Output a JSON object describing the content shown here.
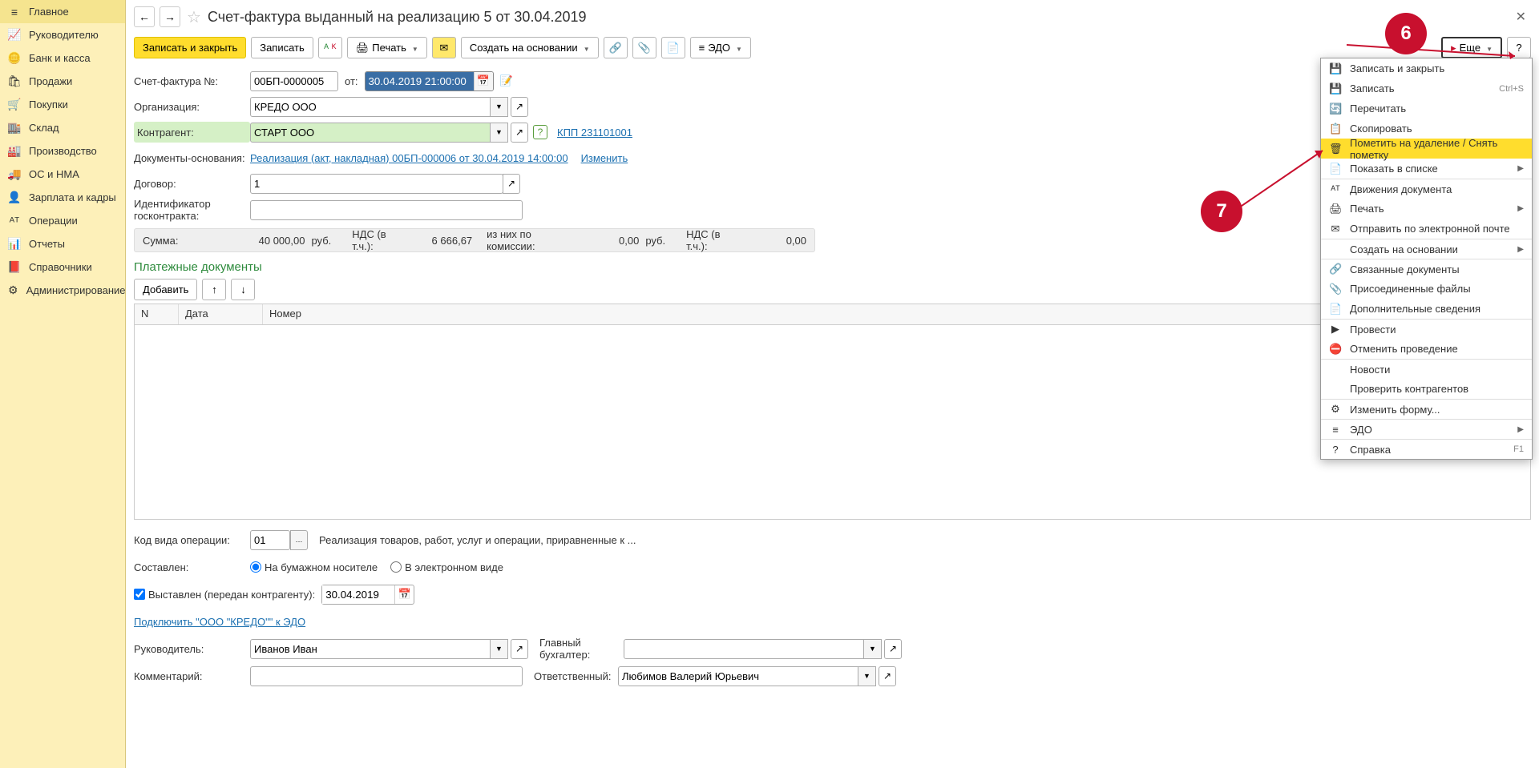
{
  "sidebar": {
    "items": [
      {
        "label": "Главное",
        "icon": "≡"
      },
      {
        "label": "Руководителю",
        "icon": "📈"
      },
      {
        "label": "Банк и касса",
        "icon": "🪙"
      },
      {
        "label": "Продажи",
        "icon": "🛍"
      },
      {
        "label": "Покупки",
        "icon": "🛒"
      },
      {
        "label": "Склад",
        "icon": "🏬"
      },
      {
        "label": "Производство",
        "icon": "🏭"
      },
      {
        "label": "ОС и НМА",
        "icon": "🚚"
      },
      {
        "label": "Зарплата и кадры",
        "icon": "👤"
      },
      {
        "label": "Операции",
        "icon": "ᴬᵀ"
      },
      {
        "label": "Отчеты",
        "icon": "📊"
      },
      {
        "label": "Справочники",
        "icon": "📕"
      },
      {
        "label": "Администрирование",
        "icon": "⚙"
      }
    ]
  },
  "header": {
    "title": "Счет-фактура выданный на реализацию 5 от 30.04.2019"
  },
  "toolbar": {
    "save_close": "Записать и закрыть",
    "save": "Записать",
    "print": "Печать",
    "create_based": "Создать на основании",
    "edo": "ЭДО",
    "more": "Еще",
    "help": "?"
  },
  "form": {
    "number_label": "Счет-фактура №:",
    "number_value": "00БП-0000005",
    "from_label": "от:",
    "date_value": "30.04.2019 21:00:00",
    "org_label": "Организация:",
    "org_value": "КРЕДО ООО",
    "contragent_label": "Контрагент:",
    "contragent_value": "СТАРТ ООО",
    "kpp_link": "КПП 231101001",
    "basis_label": "Документы-основания:",
    "basis_link": "Реализация (акт, накладная) 00БП-000006 от 30.04.2019 14:00:00",
    "basis_change": "Изменить",
    "contract_label": "Договор:",
    "contract_value": "1",
    "goscontract_label": "Идентификатор госконтракта:",
    "goscontract_value": ""
  },
  "totals": {
    "sum_label": "Сумма:",
    "sum_value": "40 000,00",
    "currency": "руб.",
    "vat_incl_label": "НДС (в т.ч.):",
    "vat_incl_value": "6 666,67",
    "commission_label": "из них по комиссии:",
    "commission_value": "0,00",
    "commission_currency": "руб.",
    "vat2_label": "НДС (в т.ч.):",
    "vat2_value": "0,00"
  },
  "payments": {
    "title": "Платежные документы",
    "add_btn": "Добавить",
    "columns": {
      "n": "N",
      "date": "Дата",
      "number": "Номер"
    }
  },
  "bottom": {
    "op_code_label": "Код вида операции:",
    "op_code_value": "01",
    "op_code_desc": "Реализация товаров, работ, услуг и операции, приравненные к ...",
    "compiled_label": "Составлен:",
    "radio_paper": "На бумажном носителе",
    "radio_electronic": "В электронном виде",
    "issued_checkbox": "Выставлен (передан контрагенту):",
    "issued_date": "30.04.2019",
    "edo_link": "Подключить \"ООО \"КРЕДО\"\" к ЭДО",
    "manager_label": "Руководитель:",
    "manager_value": "Иванов Иван",
    "accountant_label": "Главный бухгалтер:",
    "accountant_value": "",
    "comment_label": "Комментарий:",
    "comment_value": "",
    "responsible_label": "Ответственный:",
    "responsible_value": "Любимов Валерий Юрьевич"
  },
  "menu": {
    "items": [
      {
        "icon": "💾",
        "text": "Записать и закрыть",
        "shortcut": ""
      },
      {
        "icon": "💾",
        "text": "Записать",
        "shortcut": "Ctrl+S"
      },
      {
        "icon": "🔄",
        "text": "Перечитать",
        "shortcut": ""
      },
      {
        "icon": "📋",
        "text": "Скопировать",
        "shortcut": ""
      },
      {
        "icon": "🗑",
        "text": "Пометить на удаление / Снять пометку",
        "shortcut": "",
        "highlighted": true
      },
      {
        "icon": "📄",
        "text": "Показать в списке",
        "shortcut": "",
        "arrow": true
      },
      {
        "icon": "ᴬᵀ",
        "text": "Движения документа",
        "shortcut": "",
        "sep": true
      },
      {
        "icon": "🖨",
        "text": "Печать",
        "shortcut": "",
        "arrow": true
      },
      {
        "icon": "✉",
        "text": "Отправить по электронной почте",
        "shortcut": ""
      },
      {
        "icon": "",
        "text": "Создать на основании",
        "shortcut": "",
        "arrow": true,
        "sep": true
      },
      {
        "icon": "🔗",
        "text": "Связанные документы",
        "shortcut": "",
        "sep": true
      },
      {
        "icon": "📎",
        "text": "Присоединенные файлы",
        "shortcut": ""
      },
      {
        "icon": "📄",
        "text": "Дополнительные сведения",
        "shortcut": ""
      },
      {
        "icon": "▶",
        "text": "Провести",
        "shortcut": "",
        "sep": true
      },
      {
        "icon": "⛔",
        "text": "Отменить проведение",
        "shortcut": ""
      },
      {
        "icon": "",
        "text": "Новости",
        "shortcut": "",
        "sep": true
      },
      {
        "icon": "",
        "text": "Проверить контрагентов",
        "shortcut": ""
      },
      {
        "icon": "⚙",
        "text": "Изменить форму...",
        "shortcut": "",
        "sep": true
      },
      {
        "icon": "≡",
        "text": "ЭДО",
        "shortcut": "",
        "arrow": true,
        "sep": true
      },
      {
        "icon": "?",
        "text": "Справка",
        "shortcut": "F1",
        "sep": true
      }
    ]
  },
  "callouts": {
    "c6": "6",
    "c7": "7"
  }
}
